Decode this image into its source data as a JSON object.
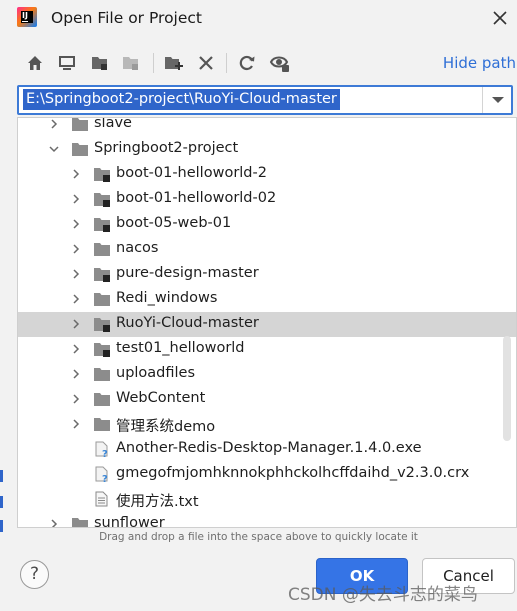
{
  "window": {
    "title": "Open File or Project"
  },
  "toolbar": {
    "buttons": [
      "home-icon",
      "desktop-icon",
      "project-folder-icon",
      "module-folder-icon",
      "new-folder-icon",
      "delete-icon",
      "refresh-icon",
      "show-hidden-icon"
    ],
    "hide_path_label": "Hide path"
  },
  "path": {
    "value": "E:\\Springboot2-project\\RuoYi-Cloud-master"
  },
  "tree": {
    "rows": [
      {
        "label": "slave",
        "level": 1,
        "expanded": false,
        "type": "folder"
      },
      {
        "label": "Springboot2-project",
        "level": 1,
        "expanded": true,
        "type": "folder"
      },
      {
        "label": "boot-01-helloworld-2",
        "level": 2,
        "expanded": false,
        "type": "project"
      },
      {
        "label": "boot-01-helloworld-02",
        "level": 2,
        "expanded": false,
        "type": "project"
      },
      {
        "label": "boot-05-web-01",
        "level": 2,
        "expanded": false,
        "type": "project"
      },
      {
        "label": "nacos",
        "level": 2,
        "expanded": false,
        "type": "folder"
      },
      {
        "label": "pure-design-master",
        "level": 2,
        "expanded": false,
        "type": "project"
      },
      {
        "label": "Redi_windows",
        "level": 2,
        "expanded": false,
        "type": "folder"
      },
      {
        "label": "RuoYi-Cloud-master",
        "level": 2,
        "expanded": false,
        "type": "project",
        "selected": true
      },
      {
        "label": "test01_helloworld",
        "level": 2,
        "expanded": false,
        "type": "project"
      },
      {
        "label": "uploadfiles",
        "level": 2,
        "expanded": false,
        "type": "folder"
      },
      {
        "label": "WebContent",
        "level": 2,
        "expanded": false,
        "type": "folder"
      },
      {
        "label": "管理系统demo",
        "level": 2,
        "expanded": false,
        "type": "folder"
      },
      {
        "label": "Another-Redis-Desktop-Manager.1.4.0.exe",
        "level": 2,
        "type": "unknown-file"
      },
      {
        "label": "gmegofmjomhknnokphhckolhcffdaihd_v2.3.0.crx",
        "level": 2,
        "type": "unknown-file"
      },
      {
        "label": "使用方法.txt",
        "level": 2,
        "type": "text-file"
      },
      {
        "label": "sunflower",
        "level": 1,
        "expanded": false,
        "type": "folder"
      }
    ]
  },
  "hint": "Drag and drop a file into the space above to quickly locate it",
  "buttons": {
    "help": "?",
    "ok": "OK",
    "cancel": "Cancel"
  },
  "watermark": "CSDN @失去斗志的菜鸟",
  "colors": {
    "accent": "#3574e6",
    "selection": "#2f65ca",
    "link": "#2f6fd6",
    "folder": "#8c8c8c"
  }
}
